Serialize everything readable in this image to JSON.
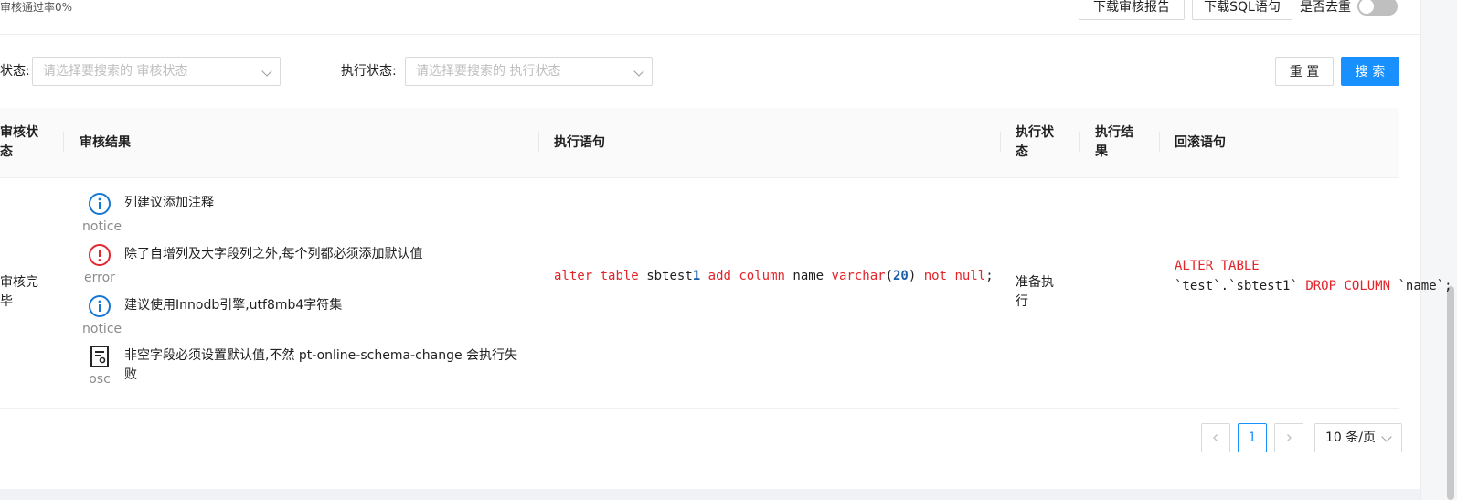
{
  "summary": {
    "pass_rate": "审核通过率0%"
  },
  "toolbar": {
    "download_report": "下载审核报告",
    "download_sql": "下载SQL语句",
    "dedupe_label": "是否去重",
    "dedupe_on": false
  },
  "filters": {
    "audit_status_label": "状态:",
    "audit_status_placeholder": "请选择要搜索的 审核状态",
    "exec_status_label": "执行状态:",
    "exec_status_placeholder": "请选择要搜索的 执行状态",
    "reset": "重 置",
    "search": "搜 索"
  },
  "table": {
    "columns": {
      "audit_status": "审核状态",
      "audit_result": "审核结果",
      "exec_sql": "执行语句",
      "exec_status": "执行状态",
      "exec_result": "执行结果",
      "rollback_sql": "回滚语句"
    },
    "rows": [
      {
        "audit_status": "审核完毕",
        "results": [
          {
            "level": "notice",
            "icon": "info-icon",
            "message": "列建议添加注释"
          },
          {
            "level": "error",
            "icon": "error-icon",
            "message": "除了自增列及大字段列之外,每个列都必须添加默认值"
          },
          {
            "level": "notice",
            "icon": "info-icon",
            "message": "建议使用Innodb引擎,utf8mb4字符集"
          },
          {
            "level": "osc",
            "icon": "document-icon",
            "message": "非空字段必须设置默认值,不然 pt-online-schema-change 会执行失败"
          }
        ],
        "exec_sql": "alter table sbtest1 add column name varchar(20) not null;",
        "exec_status": "准备执行",
        "exec_result": "",
        "rollback_sql": "ALTER TABLE `test`.`sbtest1` DROP COLUMN `name`;"
      }
    ]
  },
  "pagination": {
    "current_page": "1",
    "page_size": "10 条/页"
  },
  "colors": {
    "primary": "#1890ff",
    "error": "#e3242b",
    "info": "#1677d2",
    "sql_keyword": "#e3242b",
    "sql_number": "#1c5ea8"
  }
}
